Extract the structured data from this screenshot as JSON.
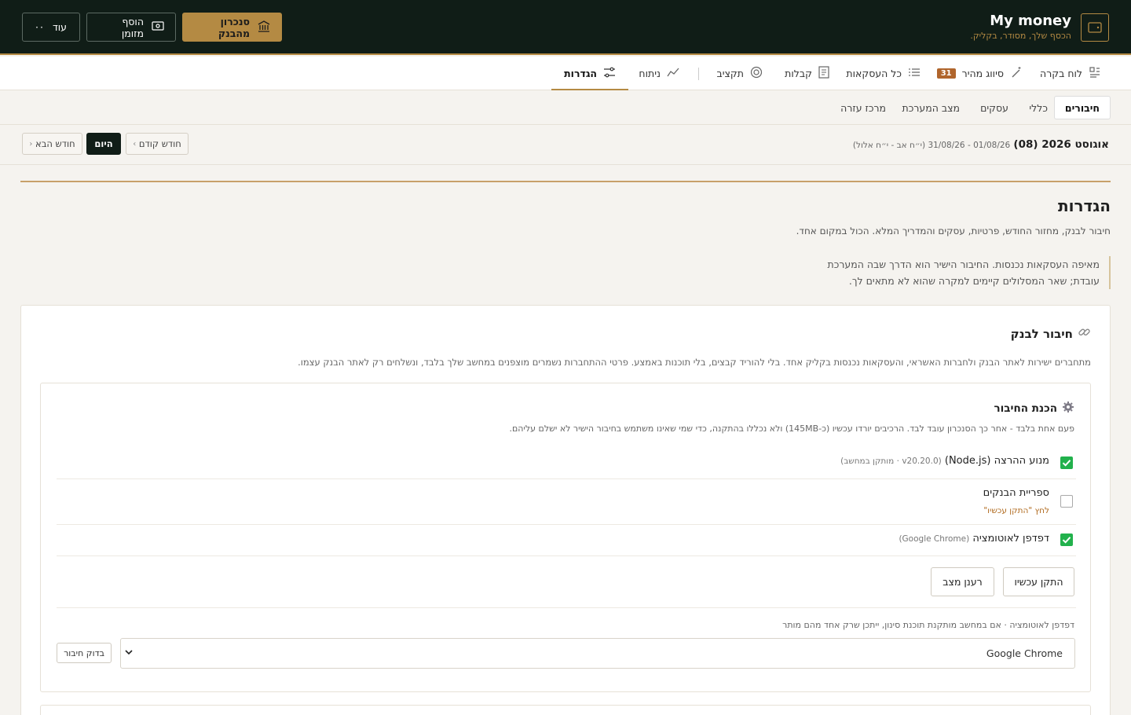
{
  "brand": {
    "title": "My money",
    "subtitle": "הכסף שלך, מסודר, בקליק."
  },
  "top_actions": {
    "sync_label": "סנכרון מהבנק",
    "add_cash_label": "הוסף מזומן",
    "more_label": "עוד"
  },
  "nav": {
    "dashboard": "לוח בקרה",
    "quick_sort": "סיווג מהיר",
    "quick_sort_badge": "31",
    "all_transactions": "כל העסקאות",
    "receipts": "קבלות",
    "budget": "תקציב",
    "analysis": "ניתוח",
    "settings": "הגדרות"
  },
  "subnav": {
    "connections": "חיבורים",
    "general": "כללי",
    "businesses": "עסקים",
    "system_status": "מצב המערכת",
    "help_center": "מרכז עזרה"
  },
  "period": {
    "month_label": "אוגוסט 2026 (08)",
    "range": "01/08/26 - 31/08/26 (י״ח אב - י״ח אלול)",
    "prev_label": "חודש קודם",
    "today_label": "היום",
    "next_label": "חודש הבא"
  },
  "page": {
    "title": "הגדרות",
    "subtitle": "חיבור לבנק, מחזור החודש, פרטיות, עסקים והמדריך המלא. הכול במקום אחד.",
    "note": "מאיפה העסקאות נכנסות. החיבור הישיר הוא הדרך שבה המערכת עובדת; שאר המסלולים קיימים למקרה שהוא לא מתאים לך."
  },
  "bank_card": {
    "title": "חיבור לבנק",
    "description": "מתחברים ישירות לאתר הבנק ולחברות האשראי, והעסקאות נכנסות בקליק אחד. בלי להוריד קבצים, בלי תוכנות באמצע. פרטי ההתחברות נשמרים מוצפנים במחשב שלך בלבד, ונשלחים רק לאתר הבנק עצמו."
  },
  "setup": {
    "title": "הכנת החיבור",
    "description": "פעם אחת בלבד - אחר כך הסנכרון עובד לבד. הרכיבים יורדו עכשיו (כ-145MB) ולא נכללו בהתקנה, כדי שמי שאינו משתמש בחיבור הישיר לא ישלם עליהם.",
    "items": [
      {
        "label": "מנוע ההרצה (Node.js)",
        "detail": "(v20.20.0 · מותקן במחשב)",
        "checked": true
      },
      {
        "label": "ספריית הבנקים",
        "hint": "לחץ \"התקן עכשיו\"",
        "checked": false
      },
      {
        "label": "דפדפן לאוטומציה",
        "detail": "(Google Chrome)",
        "checked": true
      }
    ],
    "install_label": "התקן עכשיו",
    "refresh_label": "רענן מצב",
    "browser_select_label": "דפדפן לאוטומציה · אם במחשב מותקנת תוכנת סינון, ייתכן שרק אחד מהם מותר",
    "browser_selected": "Google Chrome",
    "test_label": "בדוק חיבור"
  },
  "colors": {
    "header_bg": "#101d17",
    "accent_gold": "#b48a43",
    "check_green": "#22b14c",
    "badge": "#b0652c"
  }
}
